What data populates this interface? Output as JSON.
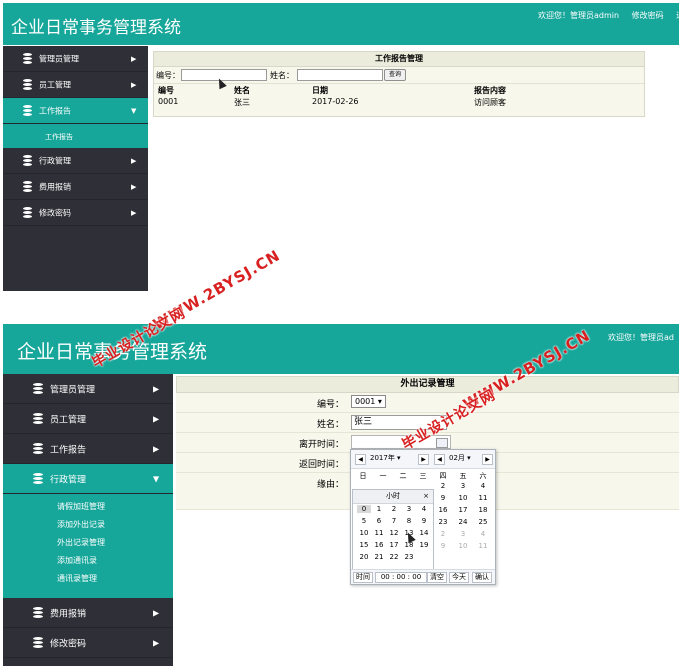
{
  "app_title": "企业日常事务管理系统",
  "header": {
    "panel1_links": [
      "欢迎您！管理员admin",
      "修改密码",
      "退"
    ],
    "panel2_link": "欢迎您！管理员ad"
  },
  "menu": [
    "管理员管理",
    "员工管理",
    "工作报告",
    "行政管理",
    "费用报销",
    "修改密码"
  ],
  "panel1": {
    "submenu": [
      "工作报告"
    ],
    "content_title": "工作报告管理",
    "search": {
      "label_id": "编号：",
      "label_name": "姓名：",
      "button": "查询"
    },
    "table": {
      "headers": [
        "编号",
        "姓名",
        "日期",
        "报告内容"
      ],
      "rows": [
        [
          "0001",
          "张三",
          "2017-02-26",
          "访问顾客"
        ]
      ]
    }
  },
  "panel2": {
    "submenu": [
      "请假加班管理",
      "添加外出记录",
      "外出记录管理",
      "添加通讯录",
      "通讯录管理"
    ],
    "content_title": "外出记录管理",
    "form": {
      "id_label": "编号：",
      "id_value": "0001",
      "name_label": "姓名：",
      "name_value": "张三",
      "leave_label": "离开时间：",
      "return_label": "返回时间：",
      "reason_label": "缘由："
    }
  },
  "datepicker": {
    "year": "2017年",
    "month": "02月",
    "weekdays": [
      "日",
      "一",
      "二",
      "三",
      "四",
      "五",
      "六"
    ],
    "weeks": [
      [
        "",
        "",
        "",
        "",
        "2",
        "3",
        "4"
      ],
      [
        "",
        "",
        "",
        "",
        "9",
        "10",
        "11"
      ],
      [
        "",
        "",
        "",
        "",
        "16",
        "17",
        "18"
      ],
      [
        "",
        "",
        "",
        "",
        "23",
        "24",
        "25"
      ],
      [
        "",
        "",
        "",
        "",
        "2",
        "3",
        "4"
      ],
      [
        "",
        "",
        "",
        "",
        "9",
        "10",
        "11"
      ]
    ],
    "hour_popup": {
      "title": "小时",
      "close": "×",
      "rows": [
        [
          "0",
          "1",
          "2",
          "3",
          "4"
        ],
        [
          "5",
          "6",
          "7",
          "8",
          "9"
        ],
        [
          "10",
          "11",
          "12",
          "13",
          "14"
        ],
        [
          "15",
          "16",
          "17",
          "18",
          "19"
        ],
        [
          "20",
          "21",
          "22",
          "23",
          ""
        ]
      ]
    },
    "footer": {
      "time_label": "时间",
      "time_value": "00 : 00 : 00",
      "clear": "清空",
      "today": "今天",
      "ok": "确认"
    }
  },
  "watermark": {
    "text1": "WWW.2BYSJ.CN",
    "text2": "毕业设计论文网"
  }
}
